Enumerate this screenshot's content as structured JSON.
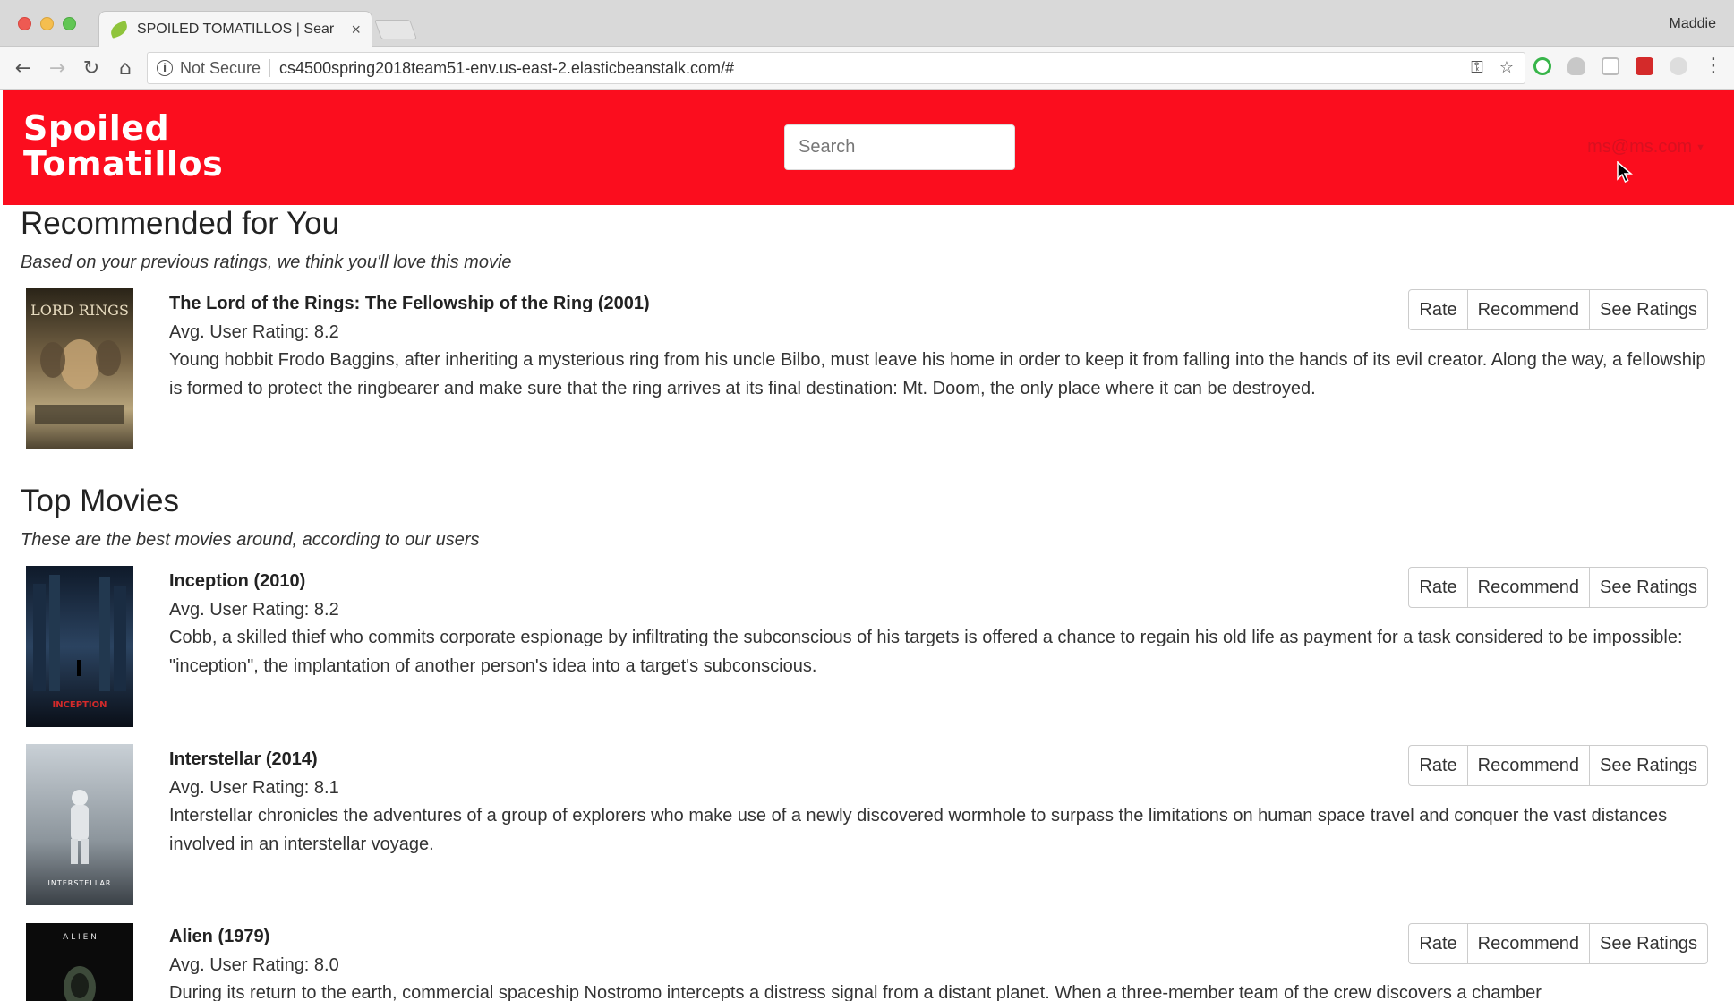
{
  "browser": {
    "tab_title": "SPOILED TOMATILLOS | Sear",
    "tab_close": "×",
    "profile": "Maddie",
    "security_label": "Not Secure",
    "url": "cs4500spring2018team51-env.us-east-2.elasticbeanstalk.com/#",
    "icons": {
      "back": "←",
      "forward": "→",
      "reload": "↻",
      "home": "⌂",
      "key": "⚿",
      "star": "☆",
      "info": "i",
      "menu": "⋮"
    }
  },
  "site": {
    "logo_line1": "Spoiled",
    "logo_line2": "Tomatillos",
    "search_placeholder": "Search",
    "user_email": "ms@ms.com",
    "user_caret": "▼",
    "brand_color": "#fb0d1e"
  },
  "recommended": {
    "title": "Recommended for You",
    "subtitle": "Based on your previous ratings, we think you'll love this movie",
    "movies": [
      {
        "title": "The Lord of the Rings: The Fellowship of the Ring (2001)",
        "rating": "Avg. User Rating: 8.2",
        "description": "Young hobbit Frodo Baggins, after inheriting a mysterious ring from his uncle Bilbo, must leave his home in order to keep it from falling into the hands of its evil creator. Along the way, a fellowship is formed to protect the ringbearer and make sure that the ring arrives at its final destination: Mt. Doom, the only place where it can be destroyed.",
        "poster_text": "LORD RINGS"
      }
    ]
  },
  "top": {
    "title": "Top Movies",
    "subtitle": "These are the best movies around, according to our users",
    "movies": [
      {
        "title": "Inception (2010)",
        "rating": "Avg. User Rating: 8.2",
        "description": "Cobb, a skilled thief who commits corporate espionage by infiltrating the subconscious of his targets is offered a chance to regain his old life as payment for a task considered to be impossible: \"inception\", the implantation of another person's idea into a target's subconscious.",
        "poster_text": "INCEPTION"
      },
      {
        "title": "Interstellar (2014)",
        "rating": "Avg. User Rating: 8.1",
        "description": "Interstellar chronicles the adventures of a group of explorers who make use of a newly discovered wormhole to surpass the limitations on human space travel and conquer the vast distances involved in an interstellar voyage.",
        "poster_text": "INTERSTELLAR"
      },
      {
        "title": "Alien (1979)",
        "rating": "Avg. User Rating: 8.0",
        "description": "During its return to the earth, commercial spaceship Nostromo intercepts a distress signal from a distant planet. When a three-member team of the crew discovers a chamber",
        "poster_text": "A L I E N"
      }
    ]
  },
  "buttons": {
    "rate": "Rate",
    "recommend": "Recommend",
    "see_ratings": "See Ratings"
  }
}
